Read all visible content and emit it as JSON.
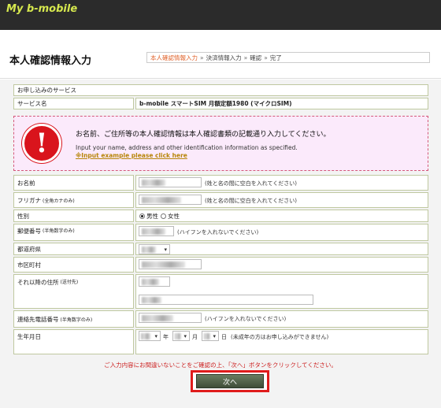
{
  "brand": "My b-mobile",
  "page_title": "本人確認情報入力",
  "steps": [
    "本人確認情報入力",
    "決済情報入力",
    "確認",
    "完了"
  ],
  "steps_sep": "»",
  "section_header": "お申し込みのサービス",
  "service": {
    "label": "サービス名",
    "value": "b-mobile スマートSIM 月額定額1980 (マイクロSIM)"
  },
  "warning": {
    "jp": "お名前、ご住所等の本人確認情報は本人確認書類の記載通り入力してください。",
    "en": "Input your name, address and other identification information as specified.",
    "link": "※Input example please click here",
    "icon": "exclamation-icon"
  },
  "fields": {
    "name": {
      "label": "お名前",
      "hint": "(姓と名の間に空白を入れてください)"
    },
    "furigana": {
      "label": "フリガナ",
      "label_note": "(全角カナのみ)",
      "hint": "(姓と名の間に空白を入れてください)"
    },
    "gender": {
      "label": "性別",
      "options": [
        "男性",
        "女性"
      ],
      "selected": "男性"
    },
    "postal": {
      "label": "郵便番号",
      "label_note": "(半角数字のみ)",
      "hint": "(ハイフンを入れないでください)"
    },
    "prefecture": {
      "label": "都道府県"
    },
    "city": {
      "label": "市区町村"
    },
    "address": {
      "label": "それ以降の住所",
      "label_note": "(送付先)"
    },
    "phone": {
      "label": "連絡先電話番号",
      "label_note": "(半角数字のみ)",
      "hint": "(ハイフンを入れないでください)"
    },
    "birthday": {
      "label": "生年月日",
      "year": "年",
      "month": "月",
      "day": "日",
      "hint": "(未成年の方はお申し込みができません)"
    }
  },
  "notice": "ご入力内容にお間違いないことをご確認の上、「次へ」ボタンをクリックしてください。",
  "next_button": "次へ",
  "colors": {
    "topbar": "#2b2b2b",
    "brand": "#d6e84e",
    "warning_icon": "#d9141c",
    "warning_bg": "#fbeafb",
    "button": "#4f5f47",
    "highlight": "#e01c1c",
    "step_active": "#e0622a"
  }
}
